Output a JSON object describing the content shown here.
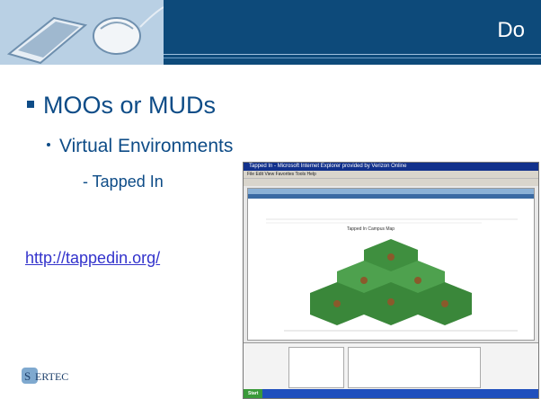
{
  "header": {
    "title": "Do",
    "colors": {
      "band": "#0d4a7a",
      "text": "#ffffff"
    }
  },
  "content": {
    "bullet_level1": "MOOs or MUDs",
    "bullet_level2": "Virtual Environments",
    "bullet_level3": "- Tapped In",
    "link": "http://tappedin.org/",
    "text_color": "#0e4c87",
    "link_color": "#3333cc"
  },
  "logo": {
    "text": "SERTEC"
  },
  "screenshot": {
    "window_title": "Tapped In - Microsoft Internet Explorer provided by Verizon Online",
    "menu": "File  Edit  View  Favorites  Tools  Help",
    "map_caption": "Tapped In Campus Map",
    "taskbar_start": "Start"
  }
}
